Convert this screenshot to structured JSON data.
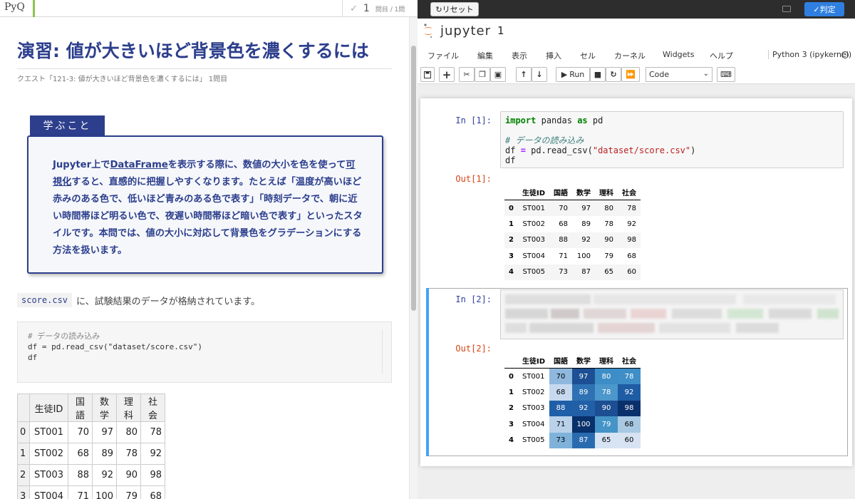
{
  "left": {
    "logo": "PyQ",
    "question_check": "✓",
    "question_num": "1",
    "question_count": "問目 / 1問",
    "title": "演習: 値が大きいほど背景色を濃くするには",
    "quest": "クエスト「121-3: 値が大きいほど背景色を濃くするには」 1問目",
    "learn_tag": "学ぶこと",
    "learn_text": {
      "p1": "Jupyter上で",
      "dataframe": "DataFrame",
      "p2": "を表示する際に、数値の大小を色を使って",
      "viz": "可視化",
      "p3": "すると、直感的に把握しやすくなります。たとえば「温度が高いほど赤みのある色で、低いほど青みのある色で表す」「時刻データで、朝に近い時間帯ほど明るい色で、夜遅い時間帯ほど暗い色で表す」といったスタイルです。本問では、値の大小に対応して背景色をグラデーションにする方法を扱います。"
    },
    "score_file": "score.csv",
    "score_text": "に、試験結果のデータが格納されています。",
    "code": {
      "line1": "# データの読み込み",
      "line2": "df = pd.read_csv(\"dataset/score.csv\")",
      "line3": "df"
    },
    "table": {
      "headers": [
        "",
        "生徒ID",
        "国語",
        "数学",
        "理科",
        "社会"
      ],
      "rows": [
        [
          "0",
          "ST001",
          "70",
          "97",
          "80",
          "78"
        ],
        [
          "1",
          "ST002",
          "68",
          "89",
          "78",
          "92"
        ],
        [
          "2",
          "ST003",
          "88",
          "92",
          "90",
          "98"
        ],
        [
          "3",
          "ST004",
          "71",
          "100",
          "79",
          "68"
        ]
      ]
    }
  },
  "right": {
    "reset_label": "↻リセット",
    "judge_label": "✓判定",
    "jupyter_label": "jupyter",
    "notebook_title": "1",
    "menu": [
      "ファイル",
      "編集",
      "表示",
      "挿入",
      "セル",
      "カーネル",
      "Widgets",
      "ヘルプ"
    ],
    "kernel": "Python 3 (ipykernel)",
    "run_label": "Run",
    "cell_type": "Code",
    "cell1": {
      "in_prompt": "In [1]:",
      "out_prompt": "Out[1]:",
      "import_kw": "import",
      "import_mod": "pandas",
      "as_kw": "as",
      "alias": "pd",
      "comment": "# データの読み込み",
      "assign_left": "df",
      "assign_op": "=",
      "call": "pd.read_csv(",
      "path": "\"dataset/score.csv\"",
      "call_end": ")",
      "last": "df"
    },
    "cell2": {
      "in_prompt": "In [2]:",
      "out_prompt": "Out[2]:"
    },
    "df": {
      "headers": [
        "",
        "生徒ID",
        "国語",
        "数学",
        "理科",
        "社会"
      ],
      "rows": [
        [
          "0",
          "ST001",
          "70",
          "97",
          "80",
          "78"
        ],
        [
          "1",
          "ST002",
          "68",
          "89",
          "78",
          "92"
        ],
        [
          "2",
          "ST003",
          "88",
          "92",
          "90",
          "98"
        ],
        [
          "3",
          "ST004",
          "71",
          "100",
          "79",
          "68"
        ],
        [
          "4",
          "ST005",
          "73",
          "87",
          "65",
          "60"
        ]
      ]
    },
    "gradient_colors": [
      [
        "#8fb8de",
        "#1c4f93",
        "#3d8dc6",
        "#3f8ec7"
      ],
      [
        "#c6d9ee",
        "#2f72b4",
        "#4c97cb",
        "#1e5ca4"
      ],
      [
        "#1f5fa8",
        "#215fa7",
        "#1b4e92",
        "#0a306b"
      ],
      [
        "#b9d2ea",
        "#08306b",
        "#4594c7",
        "#a9c9e3"
      ],
      [
        "#7fb2da",
        "#2a6bb0",
        "#d6e4f3",
        "#d7e3f2"
      ]
    ]
  }
}
